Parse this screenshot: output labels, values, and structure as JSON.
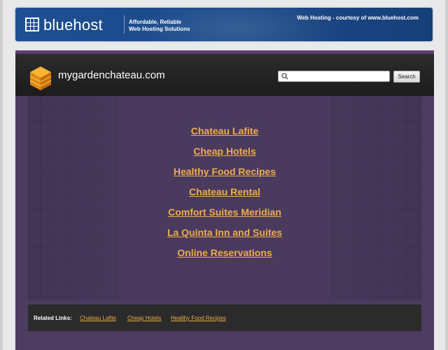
{
  "banner": {
    "brand": "bluehost",
    "tagline_line1": "Affordable, Reliable",
    "tagline_line2": "Web Hosting Solutions",
    "courtesy": "Web Hosting - courtesy of www.bluehost.com"
  },
  "site": {
    "domain": "mygardenchateau.com",
    "search_placeholder": "",
    "search_button": "Search"
  },
  "links": [
    "Chateau Lafite",
    "Cheap Hotels",
    "Healthy Food Recipes",
    "Chateau Rental",
    "Comfort Suites Meridian",
    "La Quinta Inn and Suites",
    "Online Reservations"
  ],
  "related": {
    "label": "Related Links:",
    "items": [
      "Chateau Lafite",
      "Cheap Hotels",
      "Healthy Food Recipes"
    ]
  },
  "colors": {
    "banner_blue": "#1f4f92",
    "site_purple": "#4b3c60",
    "link_orange": "#f0ac4a",
    "header_dark": "#1c1c1c"
  }
}
